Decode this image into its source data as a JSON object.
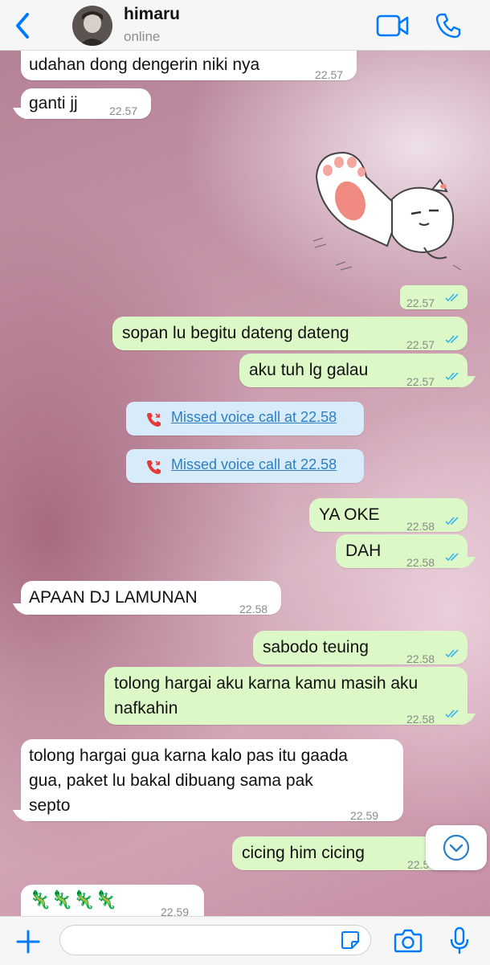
{
  "header": {
    "contact_name": "himaru",
    "status": "online",
    "icons": [
      "chevron-left-icon",
      "video-camera-icon",
      "phone-icon"
    ]
  },
  "messages": [
    {
      "dir": "in",
      "text": "udahan dong dengerin niki nya",
      "time": "22.57"
    },
    {
      "dir": "in",
      "text": "ganti jj",
      "time": "22.57"
    },
    {
      "dir": "out",
      "type": "sticker",
      "time": "22.57",
      "read": true
    },
    {
      "dir": "out",
      "text": "sopan lu begitu dateng dateng",
      "time": "22.57",
      "read": true
    },
    {
      "dir": "out",
      "text": "aku tuh lg galau",
      "time": "22.57",
      "read": true
    },
    {
      "type": "missed-call",
      "text": "Missed voice call at 22.58"
    },
    {
      "type": "missed-call",
      "text": "Missed voice call at 22.58"
    },
    {
      "dir": "out",
      "text": "YA OKE",
      "time": "22.58",
      "read": true
    },
    {
      "dir": "out",
      "text": "DAH",
      "time": "22.58",
      "read": true
    },
    {
      "dir": "in",
      "text": "APAAN DJ LAMUNAN",
      "time": "22.58"
    },
    {
      "dir": "out",
      "text": "sabodo teuing",
      "time": "22.58",
      "read": true
    },
    {
      "dir": "out",
      "lines": [
        "tolong hargai aku karna kamu masih aku",
        "nafkahin"
      ],
      "time": "22.58",
      "read": true
    },
    {
      "dir": "in",
      "lines": [
        "tolong hargai gua karna kalo pas itu gaada",
        "gua, paket lu bakal dibuang sama pak",
        "septo"
      ],
      "time": "22.59"
    },
    {
      "dir": "out",
      "text": "cicing him cicing",
      "time": "22.5"
    },
    {
      "dir": "in",
      "text": "🦎🦎🦎🦎",
      "time": "22.59"
    }
  ],
  "input": {
    "placeholder": "",
    "icons": [
      "plus-icon",
      "sticker-icon",
      "camera-icon",
      "microphone-icon"
    ]
  },
  "colors": {
    "accent": "#007aff",
    "incoming_bubble": "#ffffff",
    "outgoing_bubble": "#dcf8c6",
    "read_ticks": "#34b7f1",
    "missed_call_bg": "#d7ebfa",
    "missed_call_icon": "#e53935"
  }
}
